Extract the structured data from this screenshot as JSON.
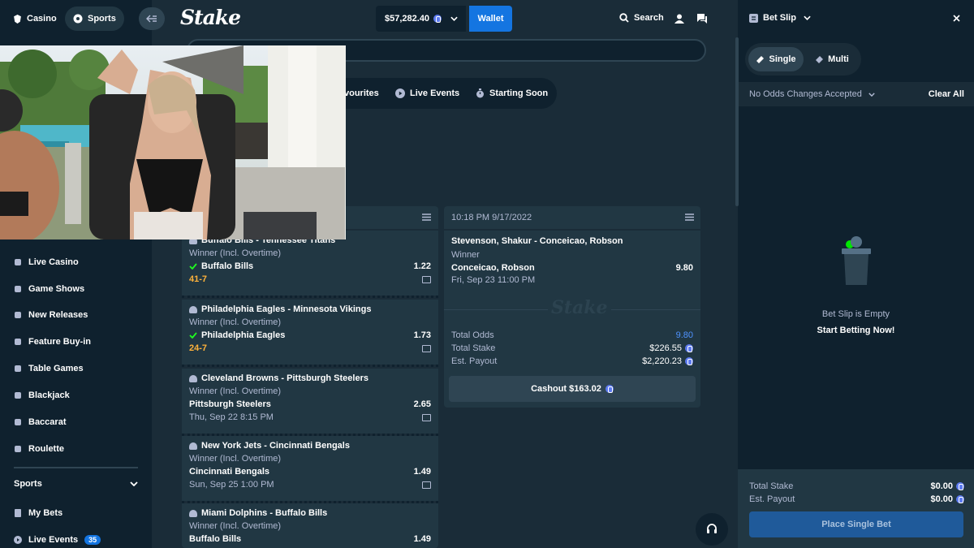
{
  "header": {
    "casino_tab": "Casino",
    "sports_tab": "Sports",
    "logo": "Stake",
    "balance": "$57,282.40",
    "wallet_button": "Wallet",
    "search_label": "Search"
  },
  "filters": {
    "favourites": "Favourites",
    "favourites_visible": "vourites",
    "live_events": "Live Events",
    "starting_soon": "Starting Soon"
  },
  "sidebar": {
    "items": [
      {
        "label": "Live Casino",
        "icon": "live-casino-icon"
      },
      {
        "label": "Game Shows",
        "icon": "game-shows-icon"
      },
      {
        "label": "New Releases",
        "icon": "rocket-icon"
      },
      {
        "label": "Feature Buy-in",
        "icon": "feature-buyin-icon"
      },
      {
        "label": "Table Games",
        "icon": "table-games-icon"
      },
      {
        "label": "Blackjack",
        "icon": "blackjack-icon"
      },
      {
        "label": "Baccarat",
        "icon": "baccarat-icon"
      },
      {
        "label": "Roulette",
        "icon": "roulette-icon"
      }
    ],
    "sports_section": "Sports",
    "my_bets": "My Bets",
    "live_events": "Live Events",
    "live_events_count": "35"
  },
  "bets": [
    {
      "match": "Buffalo Bills - Tennessee Titans",
      "market": "Winner (Incl. Overtime)",
      "pick": "Buffalo Bills",
      "odds": "1.22",
      "won": true,
      "extra": "41-7",
      "extra_type": "score"
    },
    {
      "match": "Philadelphia Eagles - Minnesota Vikings",
      "market": "Winner (Incl. Overtime)",
      "pick": "Philadelphia Eagles",
      "odds": "1.73",
      "won": true,
      "extra": "24-7",
      "extra_type": "score"
    },
    {
      "match": "Cleveland Browns - Pittsburgh Steelers",
      "market": "Winner (Incl. Overtime)",
      "pick": "Pittsburgh Steelers",
      "odds": "2.65",
      "won": false,
      "extra": "Thu, Sep 22 8:15 PM",
      "extra_type": "date"
    },
    {
      "match": "New York Jets - Cincinnati Bengals",
      "market": "Winner (Incl. Overtime)",
      "pick": "Cincinnati Bengals",
      "odds": "1.49",
      "won": false,
      "extra": "Sun, Sep 25 1:00 PM",
      "extra_type": "date"
    },
    {
      "match": "Miami Dolphins - Buffalo Bills",
      "market": "Winner (Incl. Overtime)",
      "pick": "Buffalo Bills",
      "odds": "1.49",
      "won": false,
      "extra": "",
      "extra_type": "date"
    }
  ],
  "right_card": {
    "timestamp": "10:18 PM 9/17/2022",
    "match": "Stevenson, Shakur - Conceicao, Robson",
    "market": "Winner",
    "pick": "Conceicao, Robson",
    "odds": "9.80",
    "date": "Fri, Sep 23 11:00 PM",
    "watermark": "Stake",
    "total_odds_label": "Total Odds",
    "total_odds": "9.80",
    "total_stake_label": "Total Stake",
    "total_stake": "$226.55",
    "est_payout_label": "Est. Payout",
    "est_payout": "$2,220.23",
    "cashout_label": "Cashout $163.02"
  },
  "betslip": {
    "title": "Bet Slip",
    "single_tab": "Single",
    "multi_tab": "Multi",
    "odds_setting": "No Odds Changes Accepted",
    "clear_all": "Clear All",
    "empty_title": "Bet Slip is Empty",
    "empty_cta": "Start Betting Now!",
    "total_stake_label": "Total Stake",
    "total_stake": "$0.00",
    "est_payout_label": "Est. Payout",
    "est_payout": "$0.00",
    "place_bet": "Place Single Bet"
  },
  "colors": {
    "background": "#1a2c38",
    "sidebar": "#0f212e",
    "card": "#213743",
    "wallet_blue": "#1475e1",
    "score_orange": "#ffb23b",
    "win_green": "#1fff20",
    "odds_blue": "#4f93ff"
  }
}
